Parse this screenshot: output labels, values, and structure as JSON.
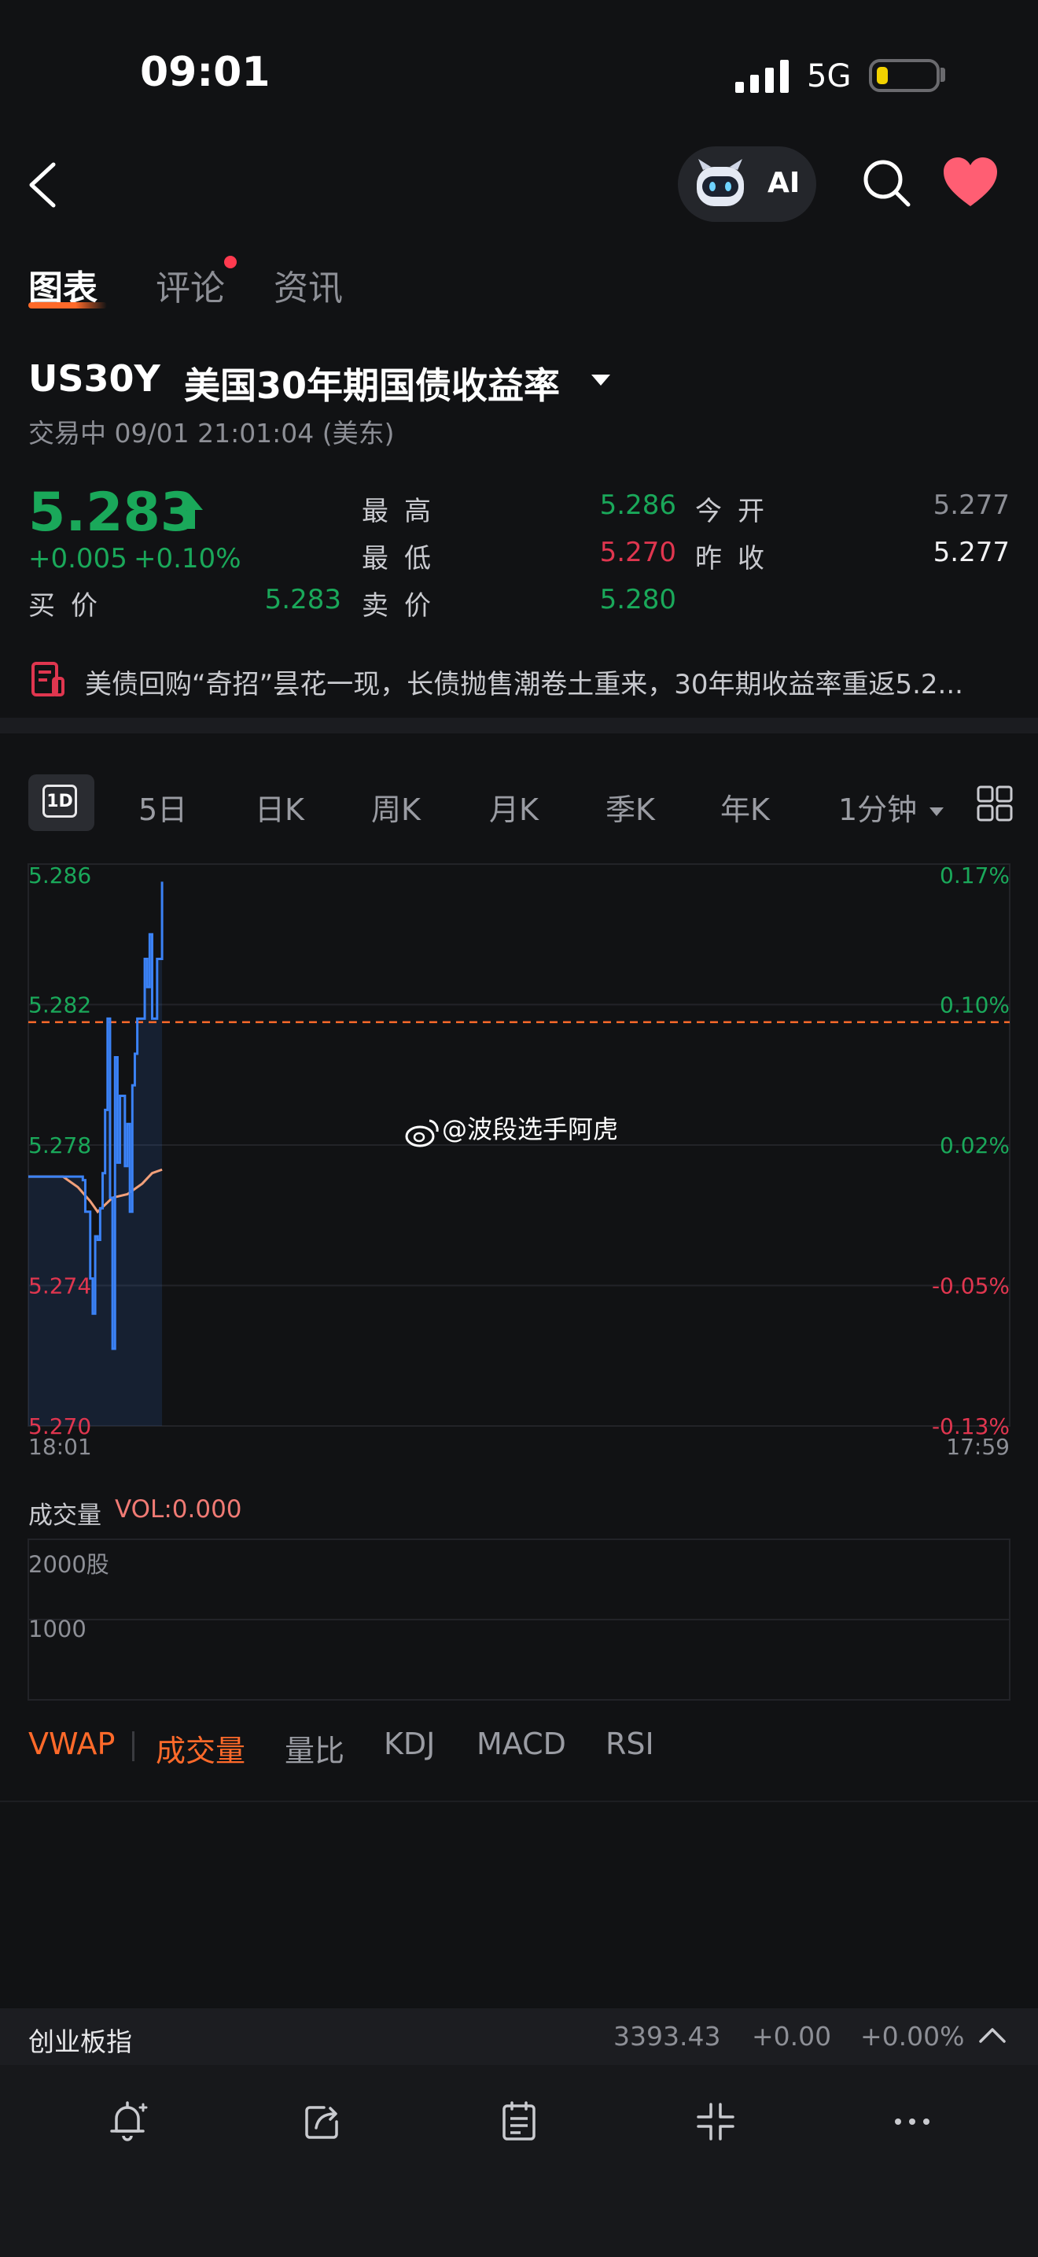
{
  "status_bar": {
    "time": "09:01",
    "network": "5G"
  },
  "nav": {
    "ai_label": "AI"
  },
  "tabs": [
    {
      "label": "图表"
    },
    {
      "label": "评论"
    },
    {
      "label": "资讯"
    }
  ],
  "instrument": {
    "symbol": "US30Y",
    "name": "美国30年期国债收益率",
    "status": "交易中 09/01 21:01:04 (美东)",
    "last_price": "5.283",
    "change": "+0.005",
    "change_pct": "+0.10%"
  },
  "quote": {
    "high_label": "最高",
    "high": "5.286",
    "open_label": "今开",
    "open": "5.277",
    "low_label": "最低",
    "low": "5.270",
    "prev_close_label": "昨收",
    "prev_close": "5.277",
    "bid_label": "买价",
    "bid": "5.283",
    "ask_label": "卖价",
    "ask": "5.280"
  },
  "news": {
    "headline": "美债回购“奇招”昙花一现，长债抛售潮卷土重来，30年期收益率重返5.2..."
  },
  "periods": [
    "1D",
    "5日",
    "日K",
    "周K",
    "月K",
    "季K",
    "年K",
    "1分钟"
  ],
  "chart_data": {
    "type": "line",
    "y_ticks_left": [
      "5.286",
      "5.282",
      "5.278",
      "5.274",
      "5.270"
    ],
    "y_ticks_right": [
      "0.17%",
      "0.10%",
      "0.02%",
      "-0.05%",
      "-0.13%"
    ],
    "x_ticks": [
      "18:01",
      "17:59"
    ],
    "ylim": [
      5.27,
      5.286
    ],
    "prev_close": 5.2815,
    "series": [
      {
        "x": [
          0,
          11,
          22,
          23,
          24,
          25,
          26,
          27,
          28,
          29,
          30,
          31,
          32,
          33,
          34,
          35,
          36,
          37,
          38,
          39,
          40,
          41,
          42,
          43,
          44,
          45,
          46,
          47,
          48,
          49,
          50,
          51,
          52,
          53,
          54
        ],
        "values": [
          5.2771,
          5.2771,
          5.277,
          5.2761,
          5.2761,
          5.2742,
          5.2732,
          5.2754,
          5.2753,
          5.2762,
          5.2772,
          5.279,
          5.2816,
          5.2765,
          5.2722,
          5.2805,
          5.2775,
          5.2794,
          5.2794,
          5.2774,
          5.2786,
          5.2761,
          5.2797,
          5.2806,
          5.2816,
          5.2816,
          5.2816,
          5.2833,
          5.2825,
          5.284,
          5.2816,
          5.2816,
          5.2833,
          5.2833,
          5.2855
        ]
      },
      {
        "name": "VWAP",
        "x": [
          0,
          14,
          20,
          25,
          28,
          34,
          40,
          46,
          50,
          54
        ],
        "values": [
          5.2771,
          5.2771,
          5.2768,
          5.2764,
          5.2761,
          5.2765,
          5.2766,
          5.2769,
          5.2772,
          5.2773
        ]
      }
    ]
  },
  "watermark": "@波段选手阿虎",
  "volume": {
    "label": "成交量",
    "value_text": "VOL:0.000",
    "y_ticks": [
      "2000股",
      "1000"
    ]
  },
  "indicators": [
    "VWAP",
    "成交量",
    "量比",
    "KDJ",
    "MACD",
    "RSI"
  ],
  "ticker": {
    "name": "创业板指",
    "price": "3393.43",
    "change": "+0.00",
    "change_pct": "+0.00%"
  },
  "colors": {
    "up": "#1aa85a",
    "down": "#e0364f",
    "accent": "#ff6a2a",
    "price_line": "#3b82f6",
    "vwap_line": "#f2a07a"
  }
}
